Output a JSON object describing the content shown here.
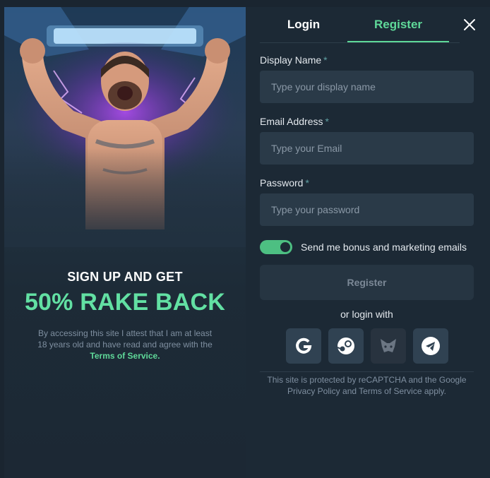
{
  "promo": {
    "headline_line1": "SIGN UP AND GET",
    "headline_line2": "50% RAKE BACK",
    "disclaimer_text": "By accessing this site I attest that I am at least 18 years old and have read and agree with the ",
    "terms_link": "Terms of Service."
  },
  "tabs": {
    "login": "Login",
    "register": "Register",
    "active": "register"
  },
  "form": {
    "display_name": {
      "label": "Display Name",
      "required_mark": "*",
      "placeholder": "Type your display name",
      "value": ""
    },
    "email": {
      "label": "Email Address",
      "required_mark": "*",
      "placeholder": "Type your Email",
      "value": ""
    },
    "password": {
      "label": "Password",
      "required_mark": "*",
      "placeholder": "Type your password",
      "value": ""
    },
    "marketing_toggle": {
      "label": "Send me bonus and marketing emails",
      "on": true
    },
    "submit_label": "Register"
  },
  "social": {
    "heading": "or login with",
    "providers": [
      "google-icon",
      "steam-icon",
      "metamask-icon",
      "telegram-icon"
    ]
  },
  "recaptcha_notice": "This site is protected by reCAPTCHA and the Google Privacy Policy and Terms of Service apply.",
  "colors": {
    "accent": "#5fd999",
    "headline_green": "#62e0a3",
    "panel": "#1c2935",
    "input_bg": "#2a3a48"
  }
}
